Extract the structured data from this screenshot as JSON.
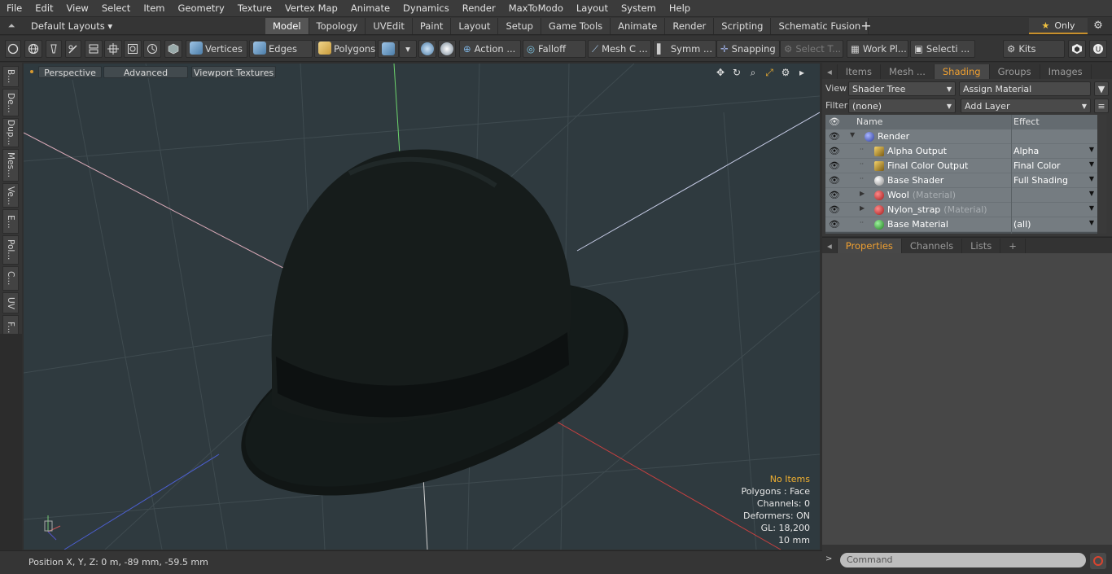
{
  "menu": [
    "File",
    "Edit",
    "View",
    "Select",
    "Item",
    "Geometry",
    "Texture",
    "Vertex Map",
    "Animate",
    "Dynamics",
    "Render",
    "MaxToModo",
    "Layout",
    "System",
    "Help"
  ],
  "layout": {
    "selector": "Default Layouts ▾",
    "plus": "+",
    "only": "Only",
    "star": "★",
    "gear": "⚙",
    "up_arrow": "⏶"
  },
  "tabs": [
    {
      "label": "Model",
      "active": true
    },
    {
      "label": "Topology"
    },
    {
      "label": "UVEdit"
    },
    {
      "label": "Paint"
    },
    {
      "label": "Layout"
    },
    {
      "label": "Setup"
    },
    {
      "label": "Game Tools"
    },
    {
      "label": "Animate"
    },
    {
      "label": "Render"
    },
    {
      "label": "Scripting"
    },
    {
      "label": "Schematic Fusion"
    }
  ],
  "toolbar": {
    "vertices": "Vertices",
    "edges": "Edges",
    "polygons": "Polygons",
    "action": "Action",
    "action_more": "...",
    "falloff": "Falloff",
    "mesh": "Mesh C ...",
    "symm": "Symm ...",
    "snapping": "Snapping",
    "select_t": "Select T...",
    "workplane": "Work Pl...",
    "selecti": "Selecti ...",
    "kits": "Kits"
  },
  "left_tools": [
    "B...",
    "De...",
    "Dup...",
    "Mes...",
    "Ve...",
    "E...",
    "Pol...",
    "C...",
    "UV",
    "F..."
  ],
  "viewport": {
    "view_mode": "Perspective",
    "advanced": "Advanced",
    "textures": "Viewport Textures",
    "info": {
      "items": "No Items",
      "polygons": "Polygons : Face",
      "channels": "Channels: 0",
      "deformers": "Deformers: ON",
      "gl": "GL: 18,200",
      "scale": "10 mm"
    }
  },
  "status": {
    "position": "Position X, Y, Z:   0 m, -89 mm, -59.5 mm"
  },
  "right_tabs": [
    {
      "label": "Items"
    },
    {
      "label": "Mesh ..."
    },
    {
      "label": "Shading",
      "active": true
    },
    {
      "label": "Groups"
    },
    {
      "label": "Images"
    }
  ],
  "shader": {
    "view_label": "View",
    "view_value": "Shader Tree",
    "assign": "Assign Material",
    "filter_label": "Filter",
    "filter_value": "(none)",
    "add_layer": "Add Layer",
    "col_name": "Name",
    "col_effect": "Effect",
    "rows": [
      {
        "name": "Render",
        "sub": "",
        "effect": "",
        "indent": 0,
        "icon": "sphere-blue"
      },
      {
        "name": "Alpha Output",
        "sub": "",
        "effect": "Alpha",
        "indent": 1,
        "icon": "output"
      },
      {
        "name": "Final Color Output",
        "sub": "",
        "effect": "Final Color",
        "indent": 1,
        "icon": "output"
      },
      {
        "name": "Base Shader",
        "sub": "",
        "effect": "Full Shading",
        "indent": 1,
        "icon": "sphere-white"
      },
      {
        "name": "Wool",
        "sub": "(Material)",
        "effect": "",
        "indent": 1,
        "icon": "material-red",
        "expand": true
      },
      {
        "name": "Nylon_strap",
        "sub": "(Material)",
        "effect": "",
        "indent": 1,
        "icon": "material-red",
        "expand": true
      },
      {
        "name": "Base Material",
        "sub": "",
        "effect": "(all)",
        "indent": 1,
        "icon": "material-green"
      }
    ]
  },
  "props_tabs": [
    {
      "label": "Properties",
      "active": true
    },
    {
      "label": "Channels"
    },
    {
      "label": "Lists"
    },
    {
      "label": "+"
    }
  ],
  "command": {
    "placeholder": "Command"
  }
}
